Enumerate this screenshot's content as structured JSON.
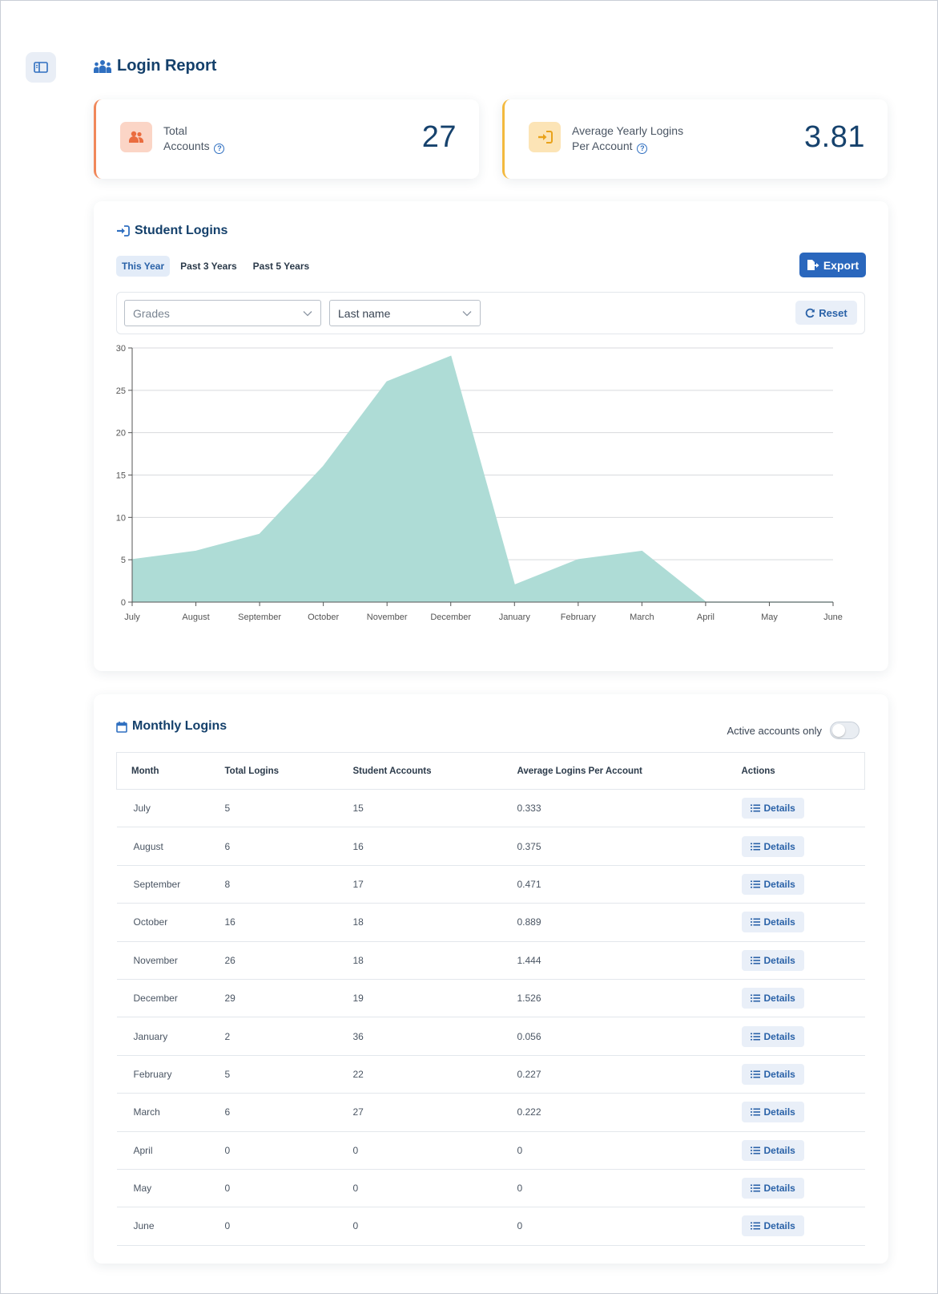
{
  "header": {
    "title": "Login Report"
  },
  "stats": {
    "total_accounts": {
      "label_line1": "Total",
      "label_line2": "Accounts",
      "value": "27"
    },
    "avg_yearly": {
      "label_line1": "Average Yearly Logins",
      "label_line2": "Per Account",
      "value": "3.81"
    }
  },
  "student_logins": {
    "title": "Student Logins",
    "tabs": [
      {
        "label": "This Year"
      },
      {
        "label": "Past 3 Years"
      },
      {
        "label": "Past 5 Years"
      }
    ],
    "export_label": "Export",
    "filters": {
      "grades_placeholder": "Grades",
      "sort_value": "Last name"
    },
    "reset_label": "Reset"
  },
  "chart_data": {
    "type": "area",
    "categories": [
      "July",
      "August",
      "September",
      "October",
      "November",
      "December",
      "January",
      "February",
      "March",
      "April",
      "May",
      "June"
    ],
    "values": [
      5,
      6,
      8,
      16,
      26,
      29,
      2,
      5,
      6,
      0,
      0,
      0
    ],
    "ylim": [
      0,
      30
    ],
    "yticks": [
      0,
      5,
      10,
      15,
      20,
      25,
      30
    ],
    "grid": true,
    "color": "#aedcd6"
  },
  "monthly_logins": {
    "title": "Monthly Logins",
    "active_only_label": "Active accounts only",
    "active_only": false,
    "columns": [
      "Month",
      "Total Logins",
      "Student Accounts",
      "Average Logins Per Account",
      "Actions"
    ],
    "details_label": "Details",
    "rows": [
      {
        "month": "July",
        "total": "5",
        "students": "15",
        "avg": "0.333"
      },
      {
        "month": "August",
        "total": "6",
        "students": "16",
        "avg": "0.375"
      },
      {
        "month": "September",
        "total": "8",
        "students": "17",
        "avg": "0.471"
      },
      {
        "month": "October",
        "total": "16",
        "students": "18",
        "avg": "0.889"
      },
      {
        "month": "November",
        "total": "26",
        "students": "18",
        "avg": "1.444"
      },
      {
        "month": "December",
        "total": "29",
        "students": "19",
        "avg": "1.526"
      },
      {
        "month": "January",
        "total": "2",
        "students": "36",
        "avg": "0.056"
      },
      {
        "month": "February",
        "total": "5",
        "students": "22",
        "avg": "0.227"
      },
      {
        "month": "March",
        "total": "6",
        "students": "27",
        "avg": "0.222"
      },
      {
        "month": "April",
        "total": "0",
        "students": "0",
        "avg": "0"
      },
      {
        "month": "May",
        "total": "0",
        "students": "0",
        "avg": "0"
      },
      {
        "month": "June",
        "total": "0",
        "students": "0",
        "avg": "0"
      }
    ]
  },
  "colors": {
    "primary": "#2a67bd",
    "heading": "#14406b",
    "orange_accent": "#f0875a",
    "yellow_accent": "#f3b93e"
  }
}
